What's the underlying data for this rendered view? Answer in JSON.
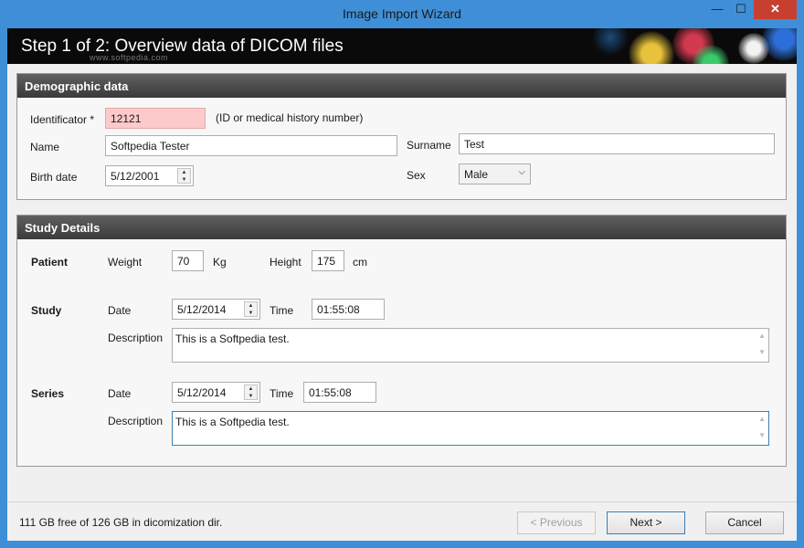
{
  "window": {
    "title": "Image Import Wizard",
    "controls": {
      "minimize": "—",
      "maximize": "☐",
      "close": "✕"
    }
  },
  "banner": {
    "heading": "Step 1 of 2: Overview data of DICOM files",
    "watermark": "www.softpedia.com"
  },
  "demographic": {
    "title": "Demographic data",
    "identificator_label": "Identificator *",
    "identificator_value": "12121",
    "identificator_hint": "(ID or medical history number)",
    "name_label": "Name",
    "name_value": "Softpedia Tester",
    "surname_label": "Surname",
    "surname_value": "Test",
    "birth_label": "Birth date",
    "birth_value": "5/12/2001",
    "sex_label": "Sex",
    "sex_value": "Male"
  },
  "study_details": {
    "title": "Study Details",
    "patient_label": "Patient",
    "weight_label": "Weight",
    "weight_value": "70",
    "weight_unit": "Kg",
    "height_label": "Height",
    "height_value": "175",
    "height_unit": "cm",
    "study_label": "Study",
    "study_date_label": "Date",
    "study_date_value": "5/12/2014",
    "study_time_label": "Time",
    "study_time_value": "01:55:08",
    "study_desc_label": "Description",
    "study_desc_value": "This is a Softpedia test.",
    "series_label": "Series",
    "series_date_label": "Date",
    "series_date_value": "5/12/2014",
    "series_time_label": "Time",
    "series_time_value": "01:55:08",
    "series_desc_label": "Description",
    "series_desc_value": "This is a Softpedia test."
  },
  "status": {
    "text": "111 GB free of 126 GB in dicomization dir."
  },
  "buttons": {
    "previous": "< Previous",
    "next": "Next >",
    "cancel": "Cancel"
  },
  "icons": {
    "spinner": "spin-updown-icon",
    "dropdown": "chevron-down-icon",
    "scroll_up": "scroll-up-arrow-icon",
    "scroll_down": "scroll-down-arrow-icon"
  },
  "colors": {
    "title_bar": "#3f8fd8",
    "close_button": "#c7402f",
    "required_field": "#fccaca",
    "panel_header": "#4a4a4a",
    "banner": "#0a0a0a"
  }
}
